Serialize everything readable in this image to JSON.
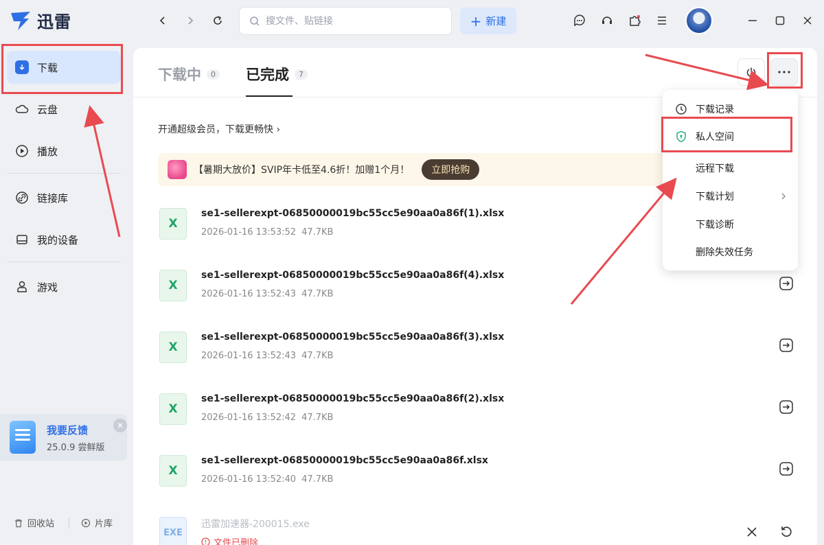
{
  "app": {
    "name": "迅雷"
  },
  "search": {
    "placeholder": "搜文件、贴链接"
  },
  "toolbar": {
    "new_label": "新建"
  },
  "sidebar": {
    "items": [
      {
        "label": "下载",
        "icon": "download-icon"
      },
      {
        "label": "云盘",
        "icon": "cloud-icon"
      },
      {
        "label": "播放",
        "icon": "play-icon"
      },
      {
        "label": "链接库",
        "icon": "link-icon"
      },
      {
        "label": "我的设备",
        "icon": "device-icon"
      },
      {
        "label": "游戏",
        "icon": "game-icon"
      }
    ],
    "feedback": {
      "title": "我要反馈",
      "version": "25.0.9 尝鲜版"
    },
    "recycle_label": "回收站",
    "library_label": "片库"
  },
  "tabs": [
    {
      "label": "下载中",
      "count": "0"
    },
    {
      "label": "已完成",
      "count": "7"
    }
  ],
  "promo": {
    "text": "开通超级会员，下载更畅快 ›"
  },
  "banner": {
    "text": "【暑期大放价】SVIP年卡低至4.6折！加赠1个月！",
    "button": "立即抢购"
  },
  "files": [
    {
      "name": "se1-sellerexpt-06850000019bc55cc5e90aa0a86f(1).xlsx",
      "date": "2026-01-16 13:53:52",
      "size": "47.7KB",
      "type": "X"
    },
    {
      "name": "se1-sellerexpt-06850000019bc55cc5e90aa0a86f(4).xlsx",
      "date": "2026-01-16 13:52:43",
      "size": "47.7KB",
      "type": "X"
    },
    {
      "name": "se1-sellerexpt-06850000019bc55cc5e90aa0a86f(3).xlsx",
      "date": "2026-01-16 13:52:43",
      "size": "47.7KB",
      "type": "X"
    },
    {
      "name": "se1-sellerexpt-06850000019bc55cc5e90aa0a86f(2).xlsx",
      "date": "2026-01-16 13:52:42",
      "size": "47.7KB",
      "type": "X"
    },
    {
      "name": "se1-sellerexpt-06850000019bc55cc5e90aa0a86f.xlsx",
      "date": "2026-01-16 13:52:40",
      "size": "47.7KB",
      "type": "X"
    }
  ],
  "deleted_file": {
    "name": "迅雷加速器-200015.exe",
    "type": "EXE",
    "status": "文件已删除"
  },
  "menu": {
    "items": [
      {
        "label": "下载记录",
        "icon": "clock-icon"
      },
      {
        "label": "私人空间",
        "icon": "shield-icon"
      },
      {
        "label": "远程下载"
      },
      {
        "label": "下载计划",
        "has_submenu": true
      },
      {
        "label": "下载诊断"
      },
      {
        "label": "删除失效任务"
      }
    ]
  },
  "colors": {
    "accent": "#2f6fe4",
    "annotation": "#e84a50",
    "excel": "#21a366"
  }
}
